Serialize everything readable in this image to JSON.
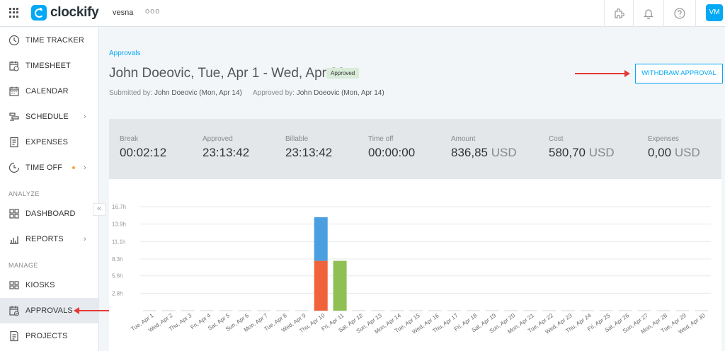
{
  "topbar": {
    "app_name": "clockify",
    "workspace": "vesna",
    "workspace_more": "ooo",
    "avatar_initials": "VM",
    "brand_color": "#03a9f4"
  },
  "sidebar": {
    "items": [
      {
        "label": "TIME TRACKER",
        "icon": "clock-icon"
      },
      {
        "label": "TIMESHEET",
        "icon": "timesheet-icon"
      },
      {
        "label": "CALENDAR",
        "icon": "calendar-icon"
      },
      {
        "label": "SCHEDULE",
        "icon": "schedule-icon",
        "chevron": "›"
      },
      {
        "label": "EXPENSES",
        "icon": "receipt-icon"
      },
      {
        "label": "TIME OFF",
        "icon": "time-off-icon",
        "chevron": "›"
      }
    ],
    "section_analyze": "ANALYZE",
    "analyze_items": [
      {
        "label": "DASHBOARD",
        "icon": "dashboard-icon"
      },
      {
        "label": "REPORTS",
        "icon": "reports-icon",
        "chevron": "›"
      }
    ],
    "section_manage": "MANAGE",
    "manage_items": [
      {
        "label": "KIOSKS",
        "icon": "kiosk-icon"
      },
      {
        "label": "APPROVALS",
        "icon": "approvals-icon",
        "active": true
      },
      {
        "label": "PROJECTS",
        "icon": "projects-icon"
      }
    ],
    "collapse_label": "«"
  },
  "main": {
    "breadcrumb": "Approvals",
    "title": "John Doeovic, Tue, Apr 1 - Wed, Apr 30",
    "status_badge": "Approved",
    "submitted_label": "Submitted by:",
    "submitted_value": "John Doeovic (Mon, Apr 14)",
    "approved_label": "Approved by:",
    "approved_value": "John Doeovic (Mon, Apr 14)",
    "withdraw_button": "WITHDRAW APPROVAL"
  },
  "stats": {
    "break_label": "Break",
    "break_value": "00:02:12",
    "approved_label": "Approved",
    "approved_value": "23:13:42",
    "billable_label": "Billable",
    "billable_value": "23:13:42",
    "timeoff_label": "Time off",
    "timeoff_value": "00:00:00",
    "amount_label": "Amount",
    "amount_value": "836,85",
    "amount_unit": "USD",
    "cost_label": "Cost",
    "cost_value": "580,70",
    "cost_unit": "USD",
    "expenses_label": "Expenses",
    "expenses_value": "0,00",
    "expenses_unit": "USD"
  },
  "chart_data": {
    "type": "bar",
    "stacked": true,
    "categories": [
      "Tue, Apr 1",
      "Wed, Apr 2",
      "Thu, Apr 3",
      "Fri, Apr 4",
      "Sat, Apr 5",
      "Sun, Apr 6",
      "Mon, Apr 7",
      "Tue, Apr 8",
      "Wed, Apr 9",
      "Thu, Apr 10",
      "Fri, Apr 11",
      "Sat, Apr 12",
      "Sun, Apr 13",
      "Mon, Apr 14",
      "Tue, Apr 15",
      "Wed, Apr 16",
      "Thu, Apr 17",
      "Fri, Apr 18",
      "Sat, Apr 19",
      "Sun, Apr 20",
      "Mon, Apr 21",
      "Tue, Apr 22",
      "Wed, Apr 23",
      "Thu, Apr 24",
      "Fri, Apr 25",
      "Sat, Apr 26",
      "Sun, Apr 27",
      "Mon, Apr 28",
      "Tue, Apr 29",
      "Wed, Apr 30"
    ],
    "series": [
      {
        "color": "#f0633a",
        "values": [
          0,
          0,
          0,
          0,
          0,
          0,
          0,
          0,
          0,
          8.0,
          0,
          0,
          0,
          0,
          0,
          0,
          0,
          0,
          0,
          0,
          0,
          0,
          0,
          0,
          0,
          0,
          0,
          0,
          0,
          0
        ]
      },
      {
        "color": "#4a9fe0",
        "values": [
          0,
          0,
          0,
          0,
          0,
          0,
          0,
          0,
          0,
          7.0,
          0,
          0,
          0,
          0,
          0,
          0,
          0,
          0,
          0,
          0,
          0,
          0,
          0,
          0,
          0,
          0,
          0,
          0,
          0,
          0
        ]
      },
      {
        "color": "#8fc053",
        "values": [
          0,
          0,
          0,
          0,
          0,
          0,
          0,
          0,
          0,
          0,
          8.0,
          0,
          0,
          0,
          0,
          0,
          0,
          0,
          0,
          0,
          0,
          0,
          0,
          0,
          0,
          0,
          0,
          0,
          0,
          0
        ]
      }
    ],
    "yticks": [
      "2.8h",
      "5.6h",
      "8.3h",
      "11.1h",
      "13.9h",
      "16.7h"
    ],
    "ylim": [
      0,
      16.7
    ],
    "grid": true
  }
}
